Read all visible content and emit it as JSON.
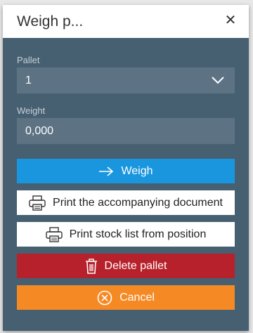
{
  "dialog": {
    "title": "Weigh p...",
    "close_label": "✕"
  },
  "pallet": {
    "label": "Pallet",
    "value": "1"
  },
  "weight": {
    "label": "Weight",
    "value": "0,000"
  },
  "buttons": {
    "weigh": "Weigh",
    "print_document": "Print the accompanying document",
    "print_stock": "Print stock list from position",
    "delete": "Delete pallet",
    "cancel": "Cancel"
  },
  "colors": {
    "dialog_bg": "#466072",
    "field_bg": "#5d7384",
    "weigh": "#1a96df",
    "delete": "#b7212b",
    "cancel": "#f58a25"
  },
  "icons": {
    "weigh": "arrow-right-icon",
    "print_document": "printer-icon",
    "print_stock": "printer-icon",
    "delete": "trash-icon",
    "cancel": "circle-x-icon",
    "pallet_dropdown": "chevron-down-icon"
  }
}
